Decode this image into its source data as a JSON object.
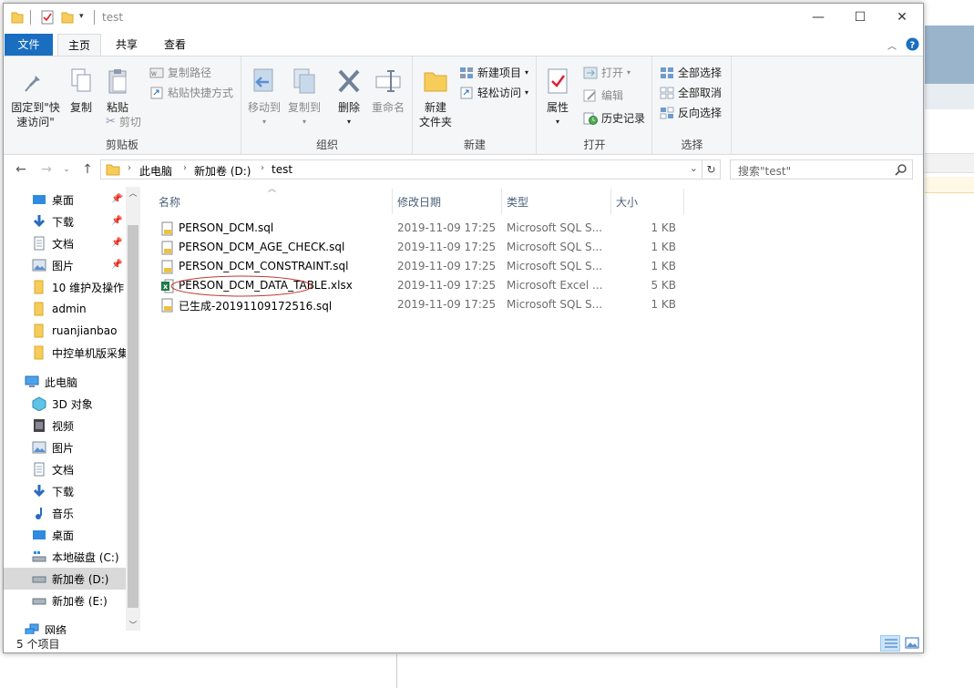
{
  "window": {
    "title": "test"
  },
  "controls": {
    "minimize": "—",
    "maximize": "☐",
    "close": "✕"
  },
  "tabs": {
    "file": "文件",
    "home": "主页",
    "share": "共享",
    "view": "查看"
  },
  "ribbon": {
    "clipboard": {
      "label": "剪贴板",
      "pin_quick_access": "固定到\"快\n速访问\"",
      "copy": "复制",
      "paste": "粘贴",
      "copy_path": "复制路径",
      "paste_shortcut": "粘贴快捷方式",
      "cut": "剪切"
    },
    "organize": {
      "label": "组织",
      "move_to": "移动到",
      "copy_to": "复制到",
      "delete": "删除",
      "rename": "重命名"
    },
    "new": {
      "label": "新建",
      "new_folder": "新建\n文件夹",
      "new_item": "新建项目",
      "easy_access": "轻松访问"
    },
    "open": {
      "label": "打开",
      "properties": "属性",
      "open": "打开",
      "edit": "编辑",
      "history": "历史记录"
    },
    "select": {
      "label": "选择",
      "select_all": "全部选择",
      "select_none": "全部取消",
      "invert": "反向选择"
    }
  },
  "address": {
    "crumbs": [
      "此电脑",
      "新加卷 (D:)",
      "test"
    ],
    "search_placeholder": "搜索\"test\""
  },
  "nav": {
    "quick": [
      {
        "label": "桌面",
        "icon": "desktop-icon",
        "pinned": true
      },
      {
        "label": "下载",
        "icon": "download-icon",
        "pinned": true
      },
      {
        "label": "文档",
        "icon": "document-icon",
        "pinned": true
      },
      {
        "label": "图片",
        "icon": "picture-icon",
        "pinned": true
      },
      {
        "label": "10 维护及操作",
        "icon": "folder-icon",
        "pinned": false
      },
      {
        "label": "admin",
        "icon": "folder-icon",
        "pinned": false
      },
      {
        "label": "ruanjianbao",
        "icon": "folder-icon",
        "pinned": false
      },
      {
        "label": "中控单机版采集",
        "icon": "folder-icon",
        "pinned": false
      }
    ],
    "this_pc": "此电脑",
    "pc_items": [
      {
        "label": "3D 对象",
        "icon": "3d-objects-icon"
      },
      {
        "label": "视频",
        "icon": "video-icon"
      },
      {
        "label": "图片",
        "icon": "picture-icon"
      },
      {
        "label": "文档",
        "icon": "document-icon"
      },
      {
        "label": "下载",
        "icon": "download-icon"
      },
      {
        "label": "音乐",
        "icon": "music-icon"
      },
      {
        "label": "桌面",
        "icon": "desktop-icon"
      },
      {
        "label": "本地磁盘 (C:)",
        "icon": "os-drive-icon"
      },
      {
        "label": "新加卷 (D:)",
        "icon": "drive-icon",
        "selected": true
      },
      {
        "label": "新加卷 (E:)",
        "icon": "drive-icon"
      }
    ],
    "network": "网络"
  },
  "columns": {
    "name": "名称",
    "date": "修改日期",
    "type": "类型",
    "size": "大小"
  },
  "files": [
    {
      "name": "PERSON_DCM.sql",
      "date": "2019-11-09 17:25",
      "type": "Microsoft SQL S...",
      "size": "1 KB",
      "icon": "sql-file-icon"
    },
    {
      "name": "PERSON_DCM_AGE_CHECK.sql",
      "date": "2019-11-09 17:25",
      "type": "Microsoft SQL S...",
      "size": "1 KB",
      "icon": "sql-file-icon"
    },
    {
      "name": "PERSON_DCM_CONSTRAINT.sql",
      "date": "2019-11-09 17:25",
      "type": "Microsoft SQL S...",
      "size": "1 KB",
      "icon": "sql-file-icon"
    },
    {
      "name": "PERSON_DCM_DATA_TABLE.xlsx",
      "date": "2019-11-09 17:25",
      "type": "Microsoft Excel ...",
      "size": "5 KB",
      "icon": "excel-file-icon",
      "circled": true
    },
    {
      "name": "已生成-20191109172516.sql",
      "date": "2019-11-09 17:25",
      "type": "Microsoft SQL S...",
      "size": "1 KB",
      "icon": "sql-file-icon"
    }
  ],
  "status": {
    "count": "5 个项目"
  },
  "colors": {
    "accent": "#1a6ec0",
    "annotation": "#c0392b"
  }
}
